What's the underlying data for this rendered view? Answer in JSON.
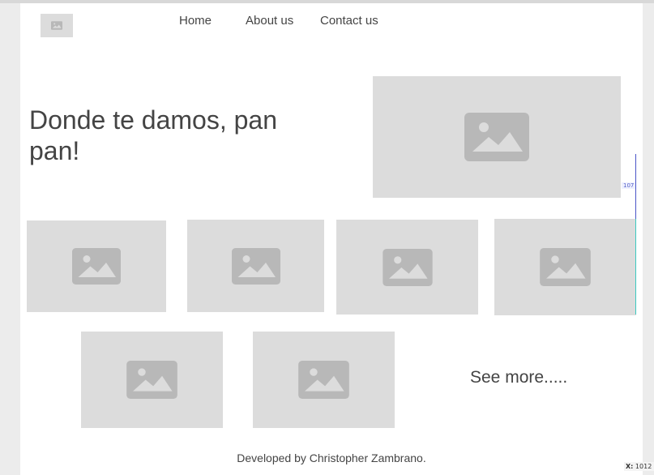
{
  "nav": {
    "logo_icon": "image-placeholder-icon",
    "links": [
      {
        "label": "Home"
      },
      {
        "label": "About us"
      },
      {
        "label": "Contact us"
      }
    ]
  },
  "hero": {
    "title": "Donde te damos, pan pan!",
    "image_icon": "image-placeholder-icon"
  },
  "gallery": {
    "image_icon": "image-placeholder-icon",
    "item_count": 6,
    "see_more_label": "See more....."
  },
  "footer": {
    "text": "Developed by Christopher Zambrano."
  },
  "overlay": {
    "guide_value": "107",
    "coord_prefix": "X:",
    "coord_value": "1012 p"
  },
  "colors": {
    "placeholder_bg": "#dcdcdc",
    "placeholder_icon": "#b8b8b8",
    "text": "#444444",
    "guide_blue": "#4a55c8",
    "guide_cyan": "#3cc9c0"
  }
}
